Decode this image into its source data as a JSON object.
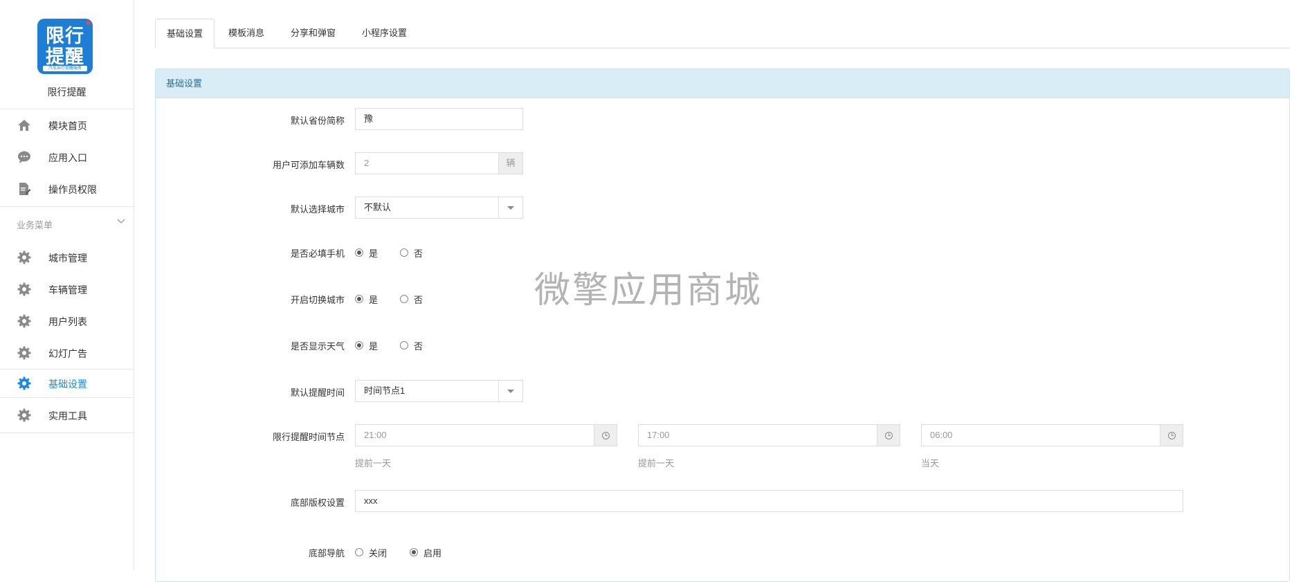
{
  "sidebar": {
    "logo": {
      "line1": "限行",
      "line2": "提醒",
      "tagline": "汽车出行提醒服务"
    },
    "app_name": "限行提醒",
    "top_items": [
      {
        "label": "模块首页",
        "icon": "home-icon"
      },
      {
        "label": "应用入口",
        "icon": "chat-icon"
      },
      {
        "label": "操作员权限",
        "icon": "edit-doc-icon"
      }
    ],
    "group_title": "业务菜单",
    "group_items": [
      {
        "label": "城市管理",
        "icon": "gear-icon"
      },
      {
        "label": "车辆管理",
        "icon": "gear-icon"
      },
      {
        "label": "用户列表",
        "icon": "gear-icon"
      },
      {
        "label": "幻灯广告",
        "icon": "gear-icon"
      },
      {
        "label": "基础设置",
        "icon": "gear-icon",
        "active": true
      },
      {
        "label": "实用工具",
        "icon": "gear-icon"
      }
    ],
    "colors": {
      "active": "#1e88e5",
      "icon": "#8a8a8a",
      "logo": "#1e7ed6"
    }
  },
  "tabs": [
    "基础设置",
    "模板消息",
    "分享和弹窗",
    "小程序设置"
  ],
  "panel_title": "基础设置",
  "form": {
    "province_label": "默认省份简称",
    "province_value": "豫",
    "vehicles_label": "用户可添加车辆数",
    "vehicles_value": "2",
    "vehicles_unit": "辆",
    "city_label": "默认选择城市",
    "city_value": "不默认",
    "phone_label": "是否必填手机",
    "switch_city_label": "开启切换城市",
    "weather_label": "是否显示天气",
    "yes": "是",
    "no": "否",
    "remind_time_label": "默认提醒时间",
    "remind_time_value": "时间节点1",
    "nodes_label": "限行提醒时间节点",
    "nodes": [
      {
        "time": "21:00",
        "hint": "提前一天"
      },
      {
        "time": "17:00",
        "hint": "提前一天"
      },
      {
        "time": "06:00",
        "hint": "当天"
      }
    ],
    "copyright_label": "底部版权设置",
    "copyright_value": "xxx",
    "bottom_nav_label": "底部导航",
    "off": "关闭",
    "on": "启用"
  },
  "watermark": "微擎应用商城"
}
